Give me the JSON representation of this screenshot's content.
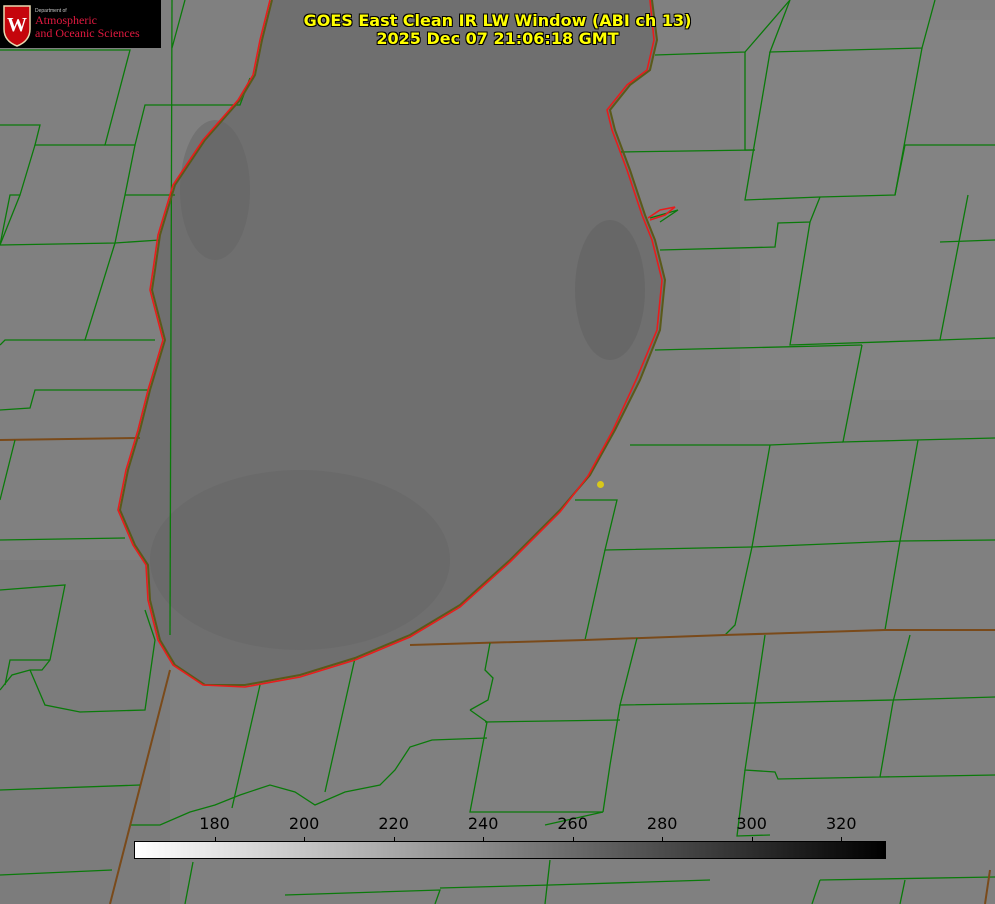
{
  "title": {
    "line1": "GOES East Clean IR LW Window (ABI ch 13)",
    "line2": "2025 Dec 07 21:06:18 GMT"
  },
  "logo": {
    "department": "Department of",
    "line1": "Atmospheric",
    "line2": "and Oceanic Sciences",
    "seal_letter": "W"
  },
  "colorbar": {
    "ticks": [
      "180",
      "200",
      "220",
      "240",
      "260",
      "280",
      "300",
      "320"
    ],
    "range": [
      162,
      330
    ],
    "colormap": "white-to-black"
  },
  "colors": {
    "background_gray": "#7f7f7f",
    "lake_gray": "#6e6e6e",
    "county_lines": "#0a7a0a",
    "shoreline": "#e81c1c",
    "title_text": "#ffff00",
    "logo_red": "#e0193f",
    "marker": "#d8c81a"
  }
}
